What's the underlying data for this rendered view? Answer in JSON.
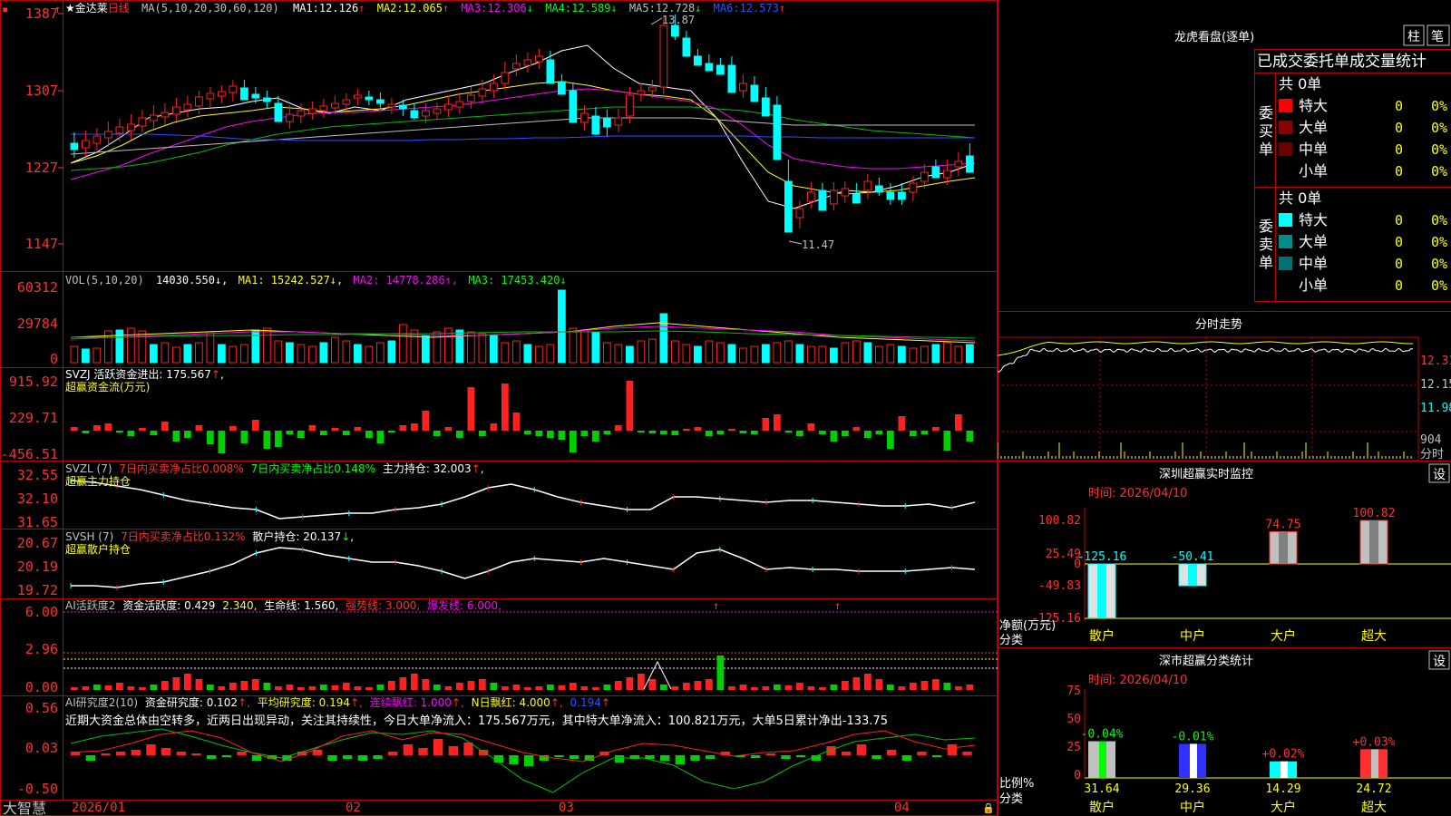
{
  "app_brand": "大智慧",
  "stock": {
    "name": "金达莱",
    "period": "日线"
  },
  "ma_header": {
    "params": "MA(5,10,20,30,60,120)",
    "items": [
      {
        "label": "MA1:",
        "value": "12.126",
        "arrow": "↑",
        "color": "#ffffff"
      },
      {
        "label": "MA2:",
        "value": "12.065",
        "arrow": "↑",
        "color": "#ffff00"
      },
      {
        "label": "MA3:",
        "value": "12.306",
        "arrow": "↓",
        "color": "#ff00ff"
      },
      {
        "label": "MA4:",
        "value": "12.589",
        "arrow": "↓",
        "color": "#00ff00"
      },
      {
        "label": "MA5:",
        "value": "12.728",
        "arrow": "↓",
        "color": "#c0c0c0"
      },
      {
        "label": "MA6:",
        "value": "12.573",
        "arrow": "↑",
        "color": "#3050ff"
      }
    ]
  },
  "price_axis": [
    "1387",
    "1307",
    "1227",
    "1147"
  ],
  "price_marks": {
    "high": "13.87",
    "low": "11.47"
  },
  "vol": {
    "header": "VOL(5,10,20)",
    "value": "14030.550↓,",
    "ma1": "MA1: 15242.527↓,",
    "ma2": "MA2: 14778.286↑,",
    "ma3": "MA3: 17453.420↓",
    "axis": [
      "60312",
      "29784",
      "0"
    ]
  },
  "svzj": {
    "header": "SVZJ  活跃资金进出: 175.567",
    "arrow": "↑",
    "tail": ",",
    "sub": "超赢资金流(万元)",
    "axis": [
      "915.92",
      "229.71",
      "-456.51"
    ]
  },
  "svzl": {
    "header": "SVZL (7)",
    "t1": "7日内买卖净占比0.008%",
    "t2": "7日内买卖净占比0.148%",
    "t3": "主力持仓: 32.003",
    "arrow": "↑",
    "tail": ",",
    "sub": "超赢主力持仓",
    "axis": [
      "32.55",
      "32.10",
      "31.65"
    ]
  },
  "svsh": {
    "header": "SVSH (7)",
    "t1": "7日内买卖净占比0.132%",
    "t2": "散户持仓: 20.137",
    "arrow": "↓",
    "tail": ",",
    "sub": "超赢散户持仓",
    "axis": [
      "20.67",
      "20.19",
      "19.72"
    ]
  },
  "ai_active": {
    "header": "AI活跃度2",
    "t1": "资金活跃度: 0.429",
    "t2": "2.340,",
    "t3": "生命线: 1.560,",
    "t4": "强势线: 3.000,",
    "t5": "爆发线: 6.000,",
    "axis": [
      "6.00",
      "2.96",
      "0.00"
    ]
  },
  "ai_research": {
    "header": "AI研究度2(10)",
    "t1": "资金研究度: 0.102",
    "t2": "平均研究度: 0.194",
    "t3": "连续飘红: 1.000",
    "t4": "N日飘红: 4.000",
    "t5": "0.194",
    "comment": "近期大资金总体由空转多，近两日出现异动，关注其持续性，今日大单净流入：175.567万元，其中特大单净流入：100.821万元，大单5日累计净出-133.75",
    "axis": [
      "0.56",
      "0.03",
      "-0.50"
    ]
  },
  "date_axis": [
    "2026/01",
    "02",
    "03",
    "04"
  ],
  "lhb": {
    "title": "龙虎看盘(逐单)",
    "btn_bar": "柱",
    "btn_pen": "笔",
    "tabs": "已成交委托单成交量统计",
    "buy_label": "委买单",
    "sell_label": "委卖单",
    "buy_total": "共 0单",
    "sell_total": "共 0单",
    "buy_rows": [
      {
        "label": "特大",
        "count": "0",
        "pct": "0%",
        "color": "#ff0000"
      },
      {
        "label": "大单",
        "count": "0",
        "pct": "0%",
        "color": "#8b0000"
      },
      {
        "label": "中单",
        "count": "0",
        "pct": "0%",
        "color": "#6b0000"
      },
      {
        "label": "小单",
        "count": "0",
        "pct": "0%",
        "color": ""
      }
    ],
    "sell_rows": [
      {
        "label": "特大",
        "count": "0",
        "pct": "0%",
        "color": "#00ffff"
      },
      {
        "label": "大单",
        "count": "0",
        "pct": "0%",
        "color": "#008b8b"
      },
      {
        "label": "中单",
        "count": "0",
        "pct": "0%",
        "color": "#007070"
      },
      {
        "label": "小单",
        "count": "0",
        "pct": "0%",
        "color": ""
      }
    ]
  },
  "fenshi": {
    "title": "分时走势",
    "axis": [
      "12.31",
      "12.15",
      "11.98"
    ],
    "vol_label": "904",
    "vol_unit": "分时"
  },
  "monitor": {
    "title": "深圳超赢实时监控",
    "settings": "设",
    "date": "时间: 2026/04/10",
    "axis": [
      "100.82",
      "25.49",
      "0",
      "-49.83",
      "-125.16"
    ],
    "ylabel": "净额(万元)",
    "xlabel": "分类",
    "bars": [
      {
        "cat": "散户",
        "value": -125.16,
        "label": "-125.16"
      },
      {
        "cat": "中户",
        "value": -50.41,
        "label": "-50.41"
      },
      {
        "cat": "大户",
        "value": 74.75,
        "label": "74.75"
      },
      {
        "cat": "超大",
        "value": 100.82,
        "label": "100.82"
      }
    ]
  },
  "classify": {
    "title": "深市超赢分类统计",
    "settings": "设",
    "date": "时间: 2026/04/10",
    "axis": [
      "75",
      "50",
      "25",
      "0"
    ],
    "ylabel": "比例%",
    "xlabel": "分类",
    "bars": [
      {
        "cat": "散户",
        "value": 31.64,
        "label": "31.64",
        "delta": "-0.04%"
      },
      {
        "cat": "中户",
        "value": 29.36,
        "label": "29.36",
        "delta": "-0.01%"
      },
      {
        "cat": "大户",
        "value": 14.29,
        "label": "14.29",
        "delta": "+0.02%"
      },
      {
        "cat": "超大",
        "value": 24.72,
        "label": "24.72",
        "delta": "+0.03%"
      }
    ]
  },
  "colors": {
    "up": "#ff2020",
    "down": "#00ffff",
    "frame": "#c00000",
    "text": "#c0c0c0"
  }
}
